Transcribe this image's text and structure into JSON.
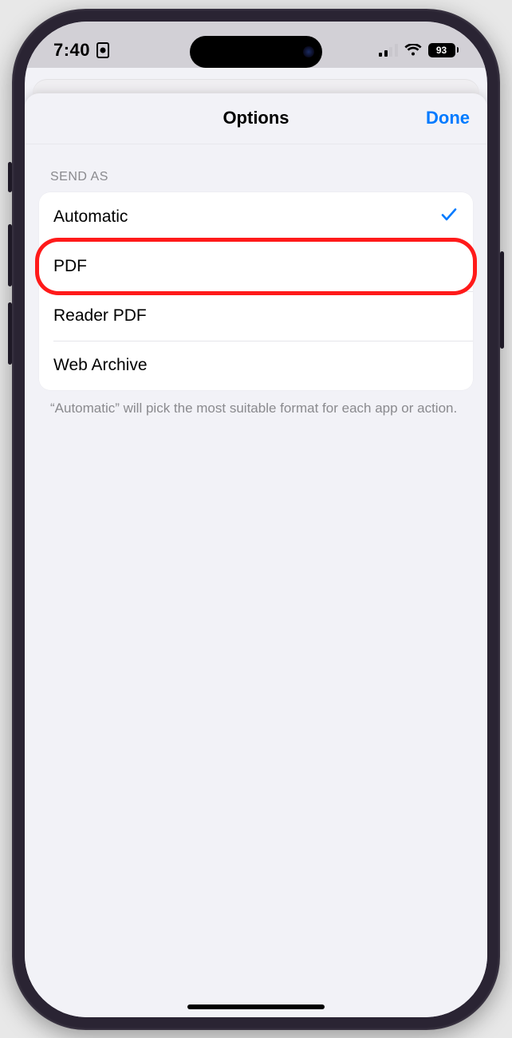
{
  "statusbar": {
    "time": "7:40",
    "battery": "93"
  },
  "nav": {
    "title": "Options",
    "done": "Done"
  },
  "section": {
    "header": "SEND AS",
    "footer": "“Automatic” will pick the most suitable format for each app or action."
  },
  "options": [
    {
      "label": "Automatic",
      "selected": true,
      "highlighted": false
    },
    {
      "label": "PDF",
      "selected": false,
      "highlighted": true
    },
    {
      "label": "Reader PDF",
      "selected": false,
      "highlighted": false
    },
    {
      "label": "Web Archive",
      "selected": false,
      "highlighted": false
    }
  ]
}
